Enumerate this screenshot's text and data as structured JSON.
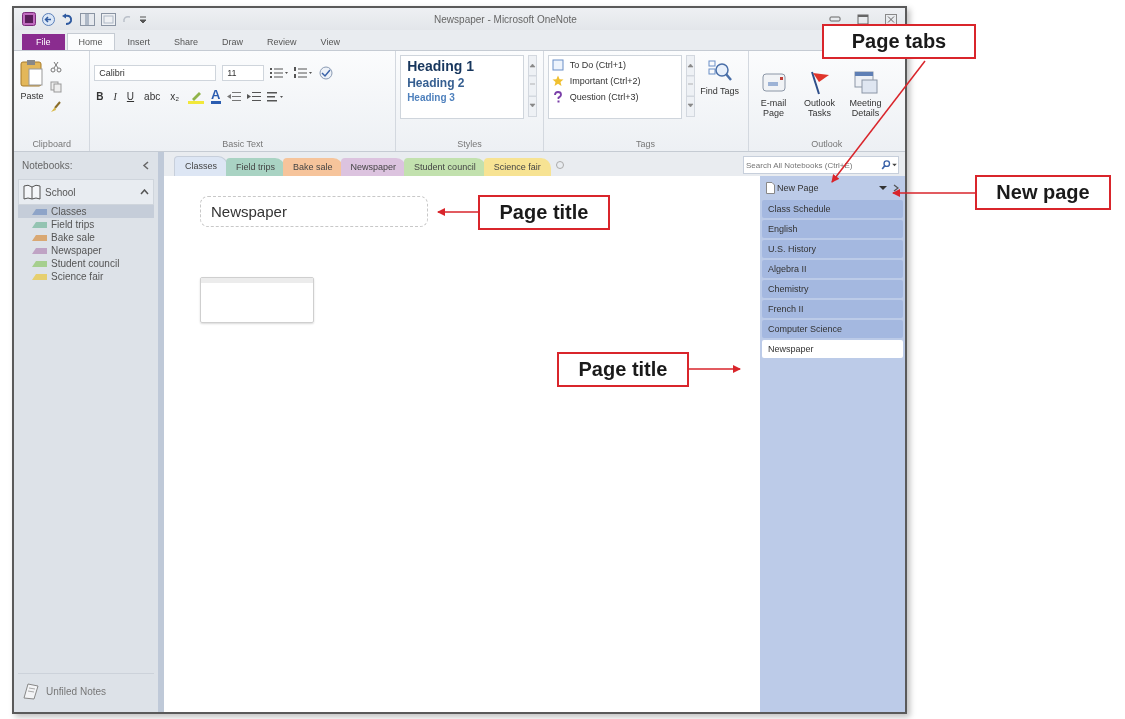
{
  "window": {
    "title": "Newspaper - Microsoft OneNote"
  },
  "ribbon": {
    "file_tab": "File",
    "tabs": [
      {
        "label": "Home",
        "selected": true
      },
      {
        "label": "Insert",
        "selected": false
      },
      {
        "label": "Share",
        "selected": false
      },
      {
        "label": "Draw",
        "selected": false
      },
      {
        "label": "Review",
        "selected": false
      },
      {
        "label": "View",
        "selected": false
      }
    ],
    "clipboard": {
      "paste": "Paste",
      "label": "Clipboard"
    },
    "basic_text": {
      "font": "Calibri",
      "size": "11",
      "format_buttons": [
        "B",
        "I",
        "U",
        "abc",
        "x₂"
      ],
      "font_color": "A",
      "label": "Basic Text"
    },
    "styles": {
      "items": [
        "Heading 1",
        "Heading 2",
        "Heading 3"
      ],
      "label": "Styles"
    },
    "tags": {
      "items": [
        {
          "label": "To Do (Ctrl+1)",
          "kind": "checkbox"
        },
        {
          "label": "Important (Ctrl+2)",
          "kind": "star"
        },
        {
          "label": "Question (Ctrl+3)",
          "kind": "question"
        }
      ],
      "find": "Find Tags",
      "label": "Tags"
    },
    "outlook": {
      "buttons": [
        {
          "label": "E-mail Page",
          "kind": "mail"
        },
        {
          "label": "Outlook Tasks",
          "kind": "flag"
        },
        {
          "label": "Meeting Details",
          "kind": "calendar"
        }
      ],
      "label": "Outlook"
    }
  },
  "navigation": {
    "label": "Notebooks:",
    "notebook": {
      "name": "School",
      "expanded": true,
      "sections": [
        {
          "name": "Classes",
          "color": "#8ea4c8",
          "selected": true
        },
        {
          "name": "Field trips",
          "color": "#94c4b2",
          "selected": false
        },
        {
          "name": "Bake sale",
          "color": "#d9a873",
          "selected": false
        },
        {
          "name": "Newspaper",
          "color": "#bfa3c4",
          "selected": false
        },
        {
          "name": "Student council",
          "color": "#a6cf8e",
          "selected": false
        },
        {
          "name": "Science fair",
          "color": "#e6cf6e",
          "selected": false
        }
      ]
    },
    "unfiled": "Unfiled Notes"
  },
  "section_tabs": [
    {
      "label": "Classes",
      "color": "#dde6f4",
      "selected": true
    },
    {
      "label": "Field trips",
      "color": "#a9d3c3",
      "selected": false
    },
    {
      "label": "Bake sale",
      "color": "#f6c49b",
      "selected": false
    },
    {
      "label": "Newspaper",
      "color": "#dcc3df",
      "selected": false
    },
    {
      "label": "Student council",
      "color": "#c2e1ae",
      "selected": false
    },
    {
      "label": "Science fair",
      "color": "#f7e393",
      "selected": false
    }
  ],
  "search": {
    "placeholder": "Search All Notebooks (Ctrl+E)"
  },
  "page": {
    "title": "Newspaper"
  },
  "page_list": {
    "new_page": "New Page",
    "pages": [
      {
        "title": "Class Schedule",
        "selected": false
      },
      {
        "title": "English",
        "selected": false
      },
      {
        "title": "U.S. History",
        "selected": false
      },
      {
        "title": "Algebra II",
        "selected": false
      },
      {
        "title": "Chemistry",
        "selected": false
      },
      {
        "title": "French II",
        "selected": false
      },
      {
        "title": "Computer Science",
        "selected": false
      },
      {
        "title": "Newspaper",
        "selected": true
      }
    ]
  },
  "callouts": [
    {
      "text": "Page tabs"
    },
    {
      "text": "New page"
    },
    {
      "text": "Page title"
    },
    {
      "text": "Page title"
    }
  ]
}
